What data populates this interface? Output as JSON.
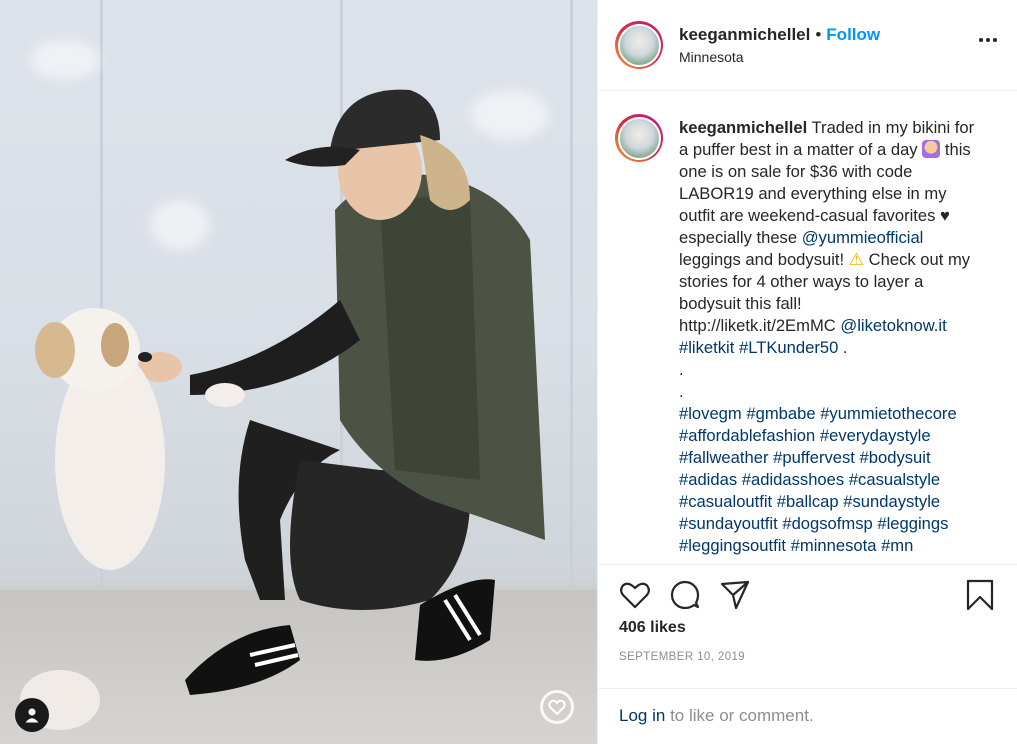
{
  "post": {
    "username": "keeganmichellel",
    "separator": "•",
    "follow_label": "Follow",
    "location": "Minnesota"
  },
  "caption": {
    "username": "keeganmichellel",
    "text_1": "Traded in my bikini for a puffer best in a matter of a day",
    "text_2": "this one is on sale for $36 with code LABOR19 and everything else in my outfit are weekend-casual favorites",
    "heart": "♥",
    "text_3": "especially these",
    "mention_1": "@yummieofficial",
    "text_4": "leggings and bodysuit!",
    "warning": "⚠",
    "text_5": "Check out my stories for 4 other ways to layer a bodysuit this fall!",
    "url": "http://liketk.it/2EmMC",
    "mention_2": "@liketoknow.it",
    "tag_1": "#liketkit",
    "tag_2": "#LTKunder50",
    "tag_end": ".",
    "dot_1": ".",
    "dot_2": ".",
    "hashtags": [
      "#lovegm",
      "#gmbabe",
      "#yummietothecore",
      "#affordablefashion",
      "#everydaystyle",
      "#fallweather",
      "#puffervest",
      "#bodysuit",
      "#adidas",
      "#adidasshoes",
      "#casualstyle",
      "#casualoutfit",
      "#ballcap",
      "#sundaystyle",
      "#sundayoutfit",
      "#dogsofmsp",
      "#leggings",
      "#leggingsoutfit",
      "#minnesota",
      "#mn"
    ]
  },
  "icons": {
    "like": "heart-icon",
    "comment": "comment-icon",
    "share": "share-icon",
    "save": "bookmark-icon",
    "more": "more-icon",
    "user_tags": "user-tag-icon",
    "ltk": "ltk-badge-icon"
  },
  "stats": {
    "likes": "406 likes",
    "date": "SEPTEMBER 10, 2019"
  },
  "login": {
    "link": "Log in",
    "text": "to like or comment."
  },
  "colors": {
    "accent": "#0095f6",
    "link": "#00376b",
    "muted": "#8e8e8e",
    "text": "#262626"
  }
}
